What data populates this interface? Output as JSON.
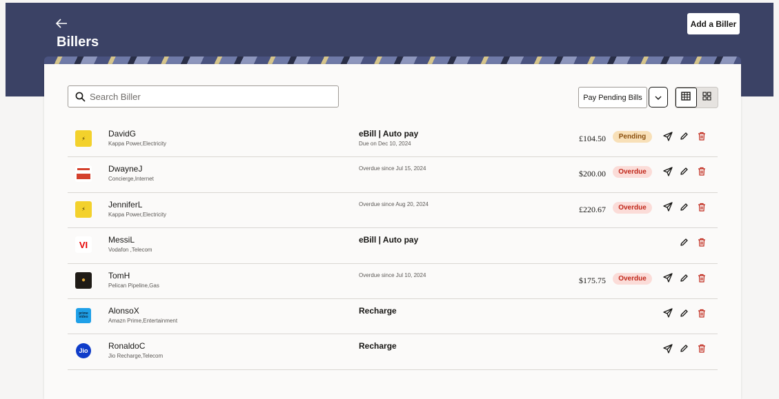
{
  "header": {
    "title": "Billers",
    "add_biller_label": "Add a Biller"
  },
  "search": {
    "placeholder": "Search Biller",
    "value": ""
  },
  "toolbar": {
    "pay_pending_label": "Pay Pending Bills"
  },
  "colors": {
    "header_bg": "#3b4265",
    "pending_bg": "#f8e0b8",
    "overdue_bg": "#fbdcd8",
    "delete_red": "#c0281b"
  },
  "billers": [
    {
      "name": "DavidG",
      "sub": "Kappa Power,Electricity",
      "logo": "kappa",
      "logo_text": "⚡",
      "type": "eBill | Auto pay",
      "due": "Due on Dec 10, 2024",
      "overdue": "",
      "amount": "£104.50",
      "status": "Pending",
      "actions": [
        "send",
        "edit",
        "delete"
      ]
    },
    {
      "name": "DwayneJ",
      "sub": "Concierge,Internet",
      "logo": "concierge",
      "logo_text": "",
      "type": "",
      "due": "",
      "overdue": "Overdue since Jul 15, 2024",
      "amount": "$200.00",
      "status": "Overdue",
      "actions": [
        "send",
        "edit",
        "delete"
      ]
    },
    {
      "name": "JenniferL",
      "sub": "Kappa Power,Electricity",
      "logo": "kappa",
      "logo_text": "⚡",
      "type": "",
      "due": "",
      "overdue": "Overdue since Aug 20, 2024",
      "amount": "£220.67",
      "status": "Overdue",
      "actions": [
        "send",
        "edit",
        "delete"
      ]
    },
    {
      "name": "MessiL",
      "sub": "Vodafon ,Telecom",
      "logo": "vodafone",
      "logo_text": "VI",
      "type": "eBill | Auto pay",
      "due": "",
      "overdue": "",
      "amount": "",
      "status": "",
      "actions": [
        "edit",
        "delete"
      ]
    },
    {
      "name": "TomH",
      "sub": "Pelican Pipeline,Gas",
      "logo": "pelican",
      "logo_text": "●",
      "type": "",
      "due": "",
      "overdue": "Overdue since Jul 10, 2024",
      "amount": "$175.75",
      "status": "Overdue",
      "actions": [
        "send",
        "edit",
        "delete"
      ]
    },
    {
      "name": "AlonsoX",
      "sub": "Amazn Prime,Entertainment",
      "logo": "prime",
      "logo_text": "prime video",
      "type": "Recharge",
      "due": "",
      "overdue": "",
      "amount": "",
      "status": "",
      "actions": [
        "send",
        "edit",
        "delete"
      ]
    },
    {
      "name": "RonaldoC",
      "sub": "Jio Recharge,Telecom",
      "logo": "jio",
      "logo_text": "Jio",
      "type": "Recharge",
      "due": "",
      "overdue": "",
      "amount": "",
      "status": "",
      "actions": [
        "send",
        "edit",
        "delete"
      ]
    }
  ]
}
